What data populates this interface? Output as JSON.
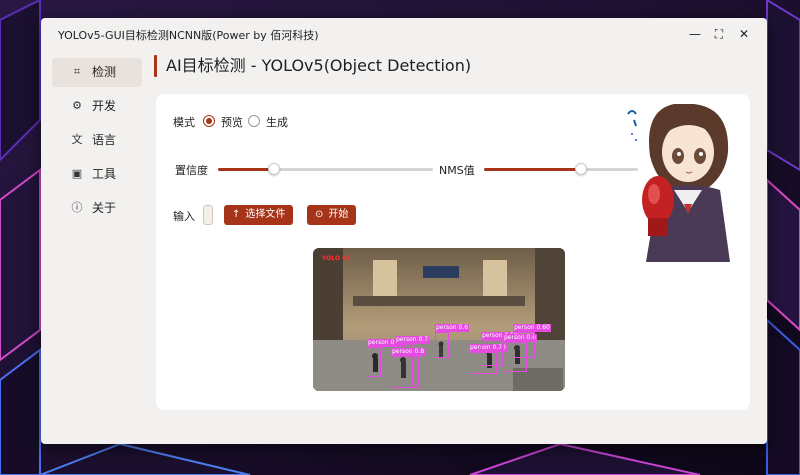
{
  "window": {
    "title": "YOLOv5-GUI目标检测NCNN版(Power by 佰河科技)",
    "minimize": "—",
    "maximize": "⛶",
    "close": "✕"
  },
  "sidebar": {
    "items": [
      {
        "label": "检测",
        "icon": "detect-icon",
        "glyph": "⌗",
        "active": true
      },
      {
        "label": "开发",
        "icon": "gear-icon",
        "glyph": "⚙",
        "active": false
      },
      {
        "label": "语言",
        "icon": "translate-icon",
        "glyph": "文",
        "active": false
      },
      {
        "label": "工具",
        "icon": "toolbox-icon",
        "glyph": "▣",
        "active": false
      },
      {
        "label": "关于",
        "icon": "info-icon",
        "glyph": "ⓘ",
        "active": false
      }
    ]
  },
  "page": {
    "title": "AI目标检测 - YOLOv5(Object Detection)"
  },
  "mode": {
    "label": "模式",
    "options": [
      {
        "label": "预览",
        "selected": true
      },
      {
        "label": "生成",
        "selected": false
      }
    ]
  },
  "confidence": {
    "label": "置信度",
    "value": 0.26
  },
  "nms": {
    "label": "NMS值",
    "value": 0.63
  },
  "input": {
    "label": "输入",
    "value": ""
  },
  "buttons": {
    "select_file": "选择文件",
    "select_file_icon": "↑",
    "start": "开始",
    "start_icon": "⊙"
  },
  "preview": {
    "tag": "YOLO v5",
    "detections": [
      {
        "label": "person 0.77"
      },
      {
        "label": "person 0.7"
      },
      {
        "label": "person 0.6"
      },
      {
        "label": "person 0.8"
      },
      {
        "label": "person 0.70"
      },
      {
        "label": "person 0.58"
      },
      {
        "label": "person 0.6"
      },
      {
        "label": "person 0.60"
      }
    ]
  },
  "colors": {
    "accent": "#a53418",
    "detection": "#e44ce0"
  }
}
